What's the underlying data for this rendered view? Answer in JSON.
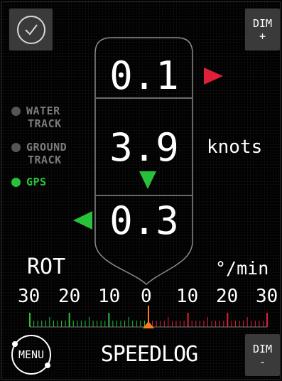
{
  "top": {
    "dim_plus": [
      "DIM",
      "+"
    ]
  },
  "bottom": {
    "dim_minus": [
      "DIM",
      "-"
    ],
    "menu_label": "MENU",
    "title": "SPEEDLOG"
  },
  "status_list": [
    {
      "line1": "WATER",
      "line2": "TRACK",
      "active": false
    },
    {
      "line1": "GROUND",
      "line2": "TRACK",
      "active": false
    },
    {
      "line1": "GPS",
      "line2": "",
      "active": true
    }
  ],
  "speed": {
    "upper": "0.1",
    "main": "3.9",
    "lower": "0.3",
    "unit": "knots"
  },
  "rot": {
    "label": "ROT",
    "unit": "°/min",
    "scale_labels": [
      "30",
      "20",
      "10",
      "0",
      "10",
      "20",
      "30"
    ],
    "value": 0
  },
  "colors": {
    "accent_green": "#28c23a",
    "accent_red": "#e0203a",
    "accent_orange": "#ff7a1a",
    "button_gray": "#3a3a3a"
  }
}
